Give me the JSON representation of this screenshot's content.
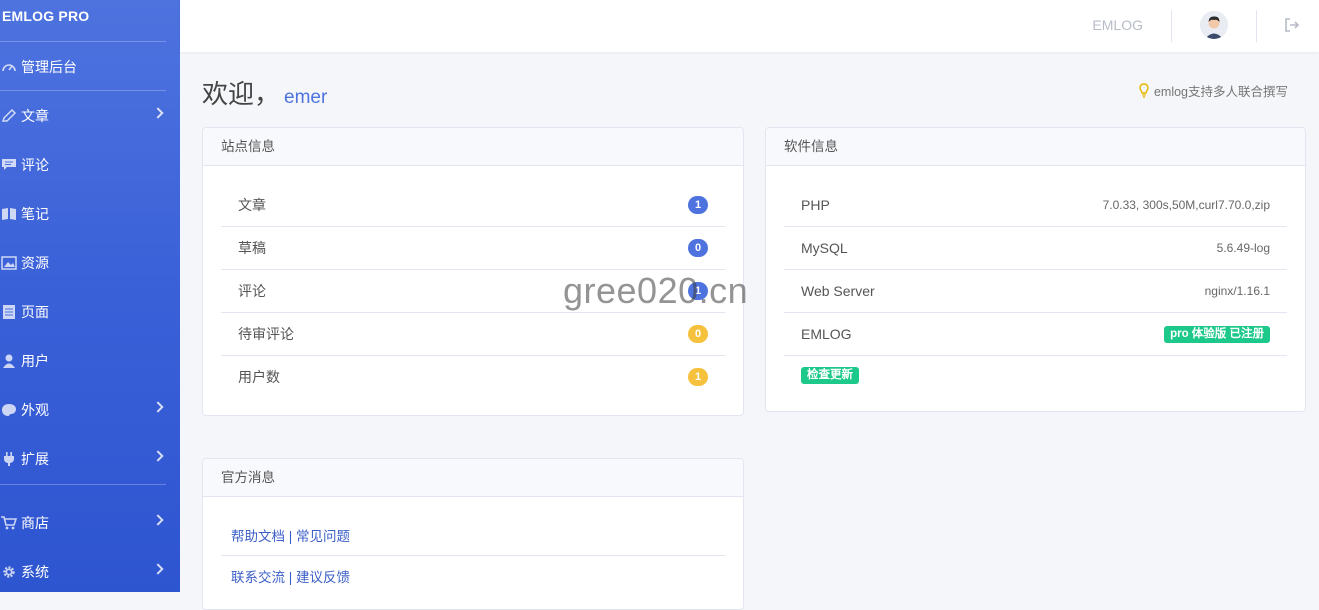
{
  "sidebar": {
    "brand": "EMLOG PRO",
    "items": [
      {
        "label": "管理后台",
        "icon": "dashboard-icon",
        "has_submenu": false
      },
      {
        "label": "文章",
        "icon": "pencil-icon",
        "has_submenu": true
      },
      {
        "label": "评论",
        "icon": "comment-icon",
        "has_submenu": false
      },
      {
        "label": "笔记",
        "icon": "note-icon",
        "has_submenu": false
      },
      {
        "label": "资源",
        "icon": "image-icon",
        "has_submenu": false
      },
      {
        "label": "页面",
        "icon": "page-icon",
        "has_submenu": false
      },
      {
        "label": "用户",
        "icon": "user-icon",
        "has_submenu": false
      },
      {
        "label": "外观",
        "icon": "palette-icon",
        "has_submenu": true
      },
      {
        "label": "扩展",
        "icon": "plug-icon",
        "has_submenu": true
      },
      {
        "label": "商店",
        "icon": "cart-icon",
        "has_submenu": true
      },
      {
        "label": "系统",
        "icon": "gear-icon",
        "has_submenu": true
      }
    ]
  },
  "topbar": {
    "site_label": "EMLOG",
    "avatar_icon": "avatar",
    "logout_icon": "logout-icon"
  },
  "welcome": {
    "greeting": "欢迎，",
    "username": "emer"
  },
  "tip": {
    "icon": "lightbulb-icon",
    "text": "emlog支持多人联合撰写"
  },
  "site_info": {
    "title": "站点信息",
    "rows": [
      {
        "label": "文章",
        "count": "1",
        "color": "#4e73df"
      },
      {
        "label": "草稿",
        "count": "0",
        "color": "#4e73df"
      },
      {
        "label": "评论",
        "count": "1",
        "color": "#4e73df"
      },
      {
        "label": "待审评论",
        "count": "0",
        "color": "#f6c23e"
      },
      {
        "label": "用户数",
        "count": "1",
        "color": "#f6c23e"
      }
    ]
  },
  "software_info": {
    "title": "软件信息",
    "rows": [
      {
        "label": "PHP",
        "value": "7.0.33, 300s,50M,curl7.70.0,zip"
      },
      {
        "label": "MySQL",
        "value": "5.6.49-log"
      },
      {
        "label": "Web Server",
        "value": "nginx/1.16.1"
      },
      {
        "label": "EMLOG",
        "value": "pro 体验版 已注册"
      }
    ],
    "check_update": "检查更新"
  },
  "official_news": {
    "title": "官方消息",
    "links": [
      {
        "a": "帮助文档",
        "sep": " | ",
        "b": "常见问题"
      },
      {
        "a": "联系交流",
        "sep": " | ",
        "b": "建议反馈"
      }
    ]
  },
  "watermark": "gree020.cn",
  "colors": {
    "accent": "#4e73df",
    "warning": "#f6c23e",
    "success": "#1cc88a"
  }
}
